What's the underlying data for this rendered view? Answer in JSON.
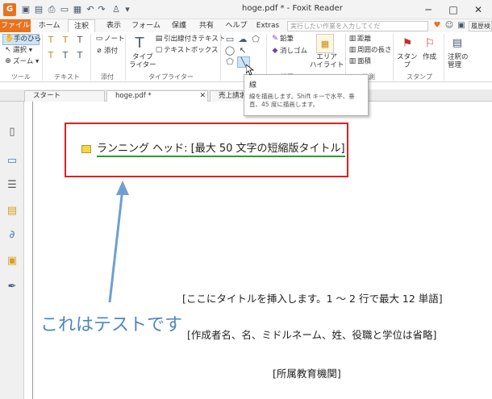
{
  "window": {
    "title": "hoge.pdf * - Foxit Reader",
    "logo": "G",
    "minimize": "─",
    "maximize": "□",
    "close": "✕"
  },
  "ribbon_tabs": {
    "file": "ファイル",
    "home": "ホーム",
    "comment": "注釈",
    "view": "表示",
    "form": "フォーム",
    "protect": "保護",
    "share": "共有",
    "help": "ヘルプ",
    "extras": "Extras"
  },
  "search": {
    "placeholder": "実行したい作業を入力してくだ",
    "find_placeholder": "履歴検"
  },
  "ribbon": {
    "tools": {
      "hand": "手のひら",
      "select": "選択",
      "zoom": "ズーム",
      "label": "ツール"
    },
    "text": {
      "label": "テキスト"
    },
    "attach": {
      "note": "ノート",
      "file": "添付",
      "label": "添付"
    },
    "typewriter": {
      "typewriter": "タイプ\nライター",
      "callout": "引出線付きテキスト",
      "textbox": "テキストボックス",
      "label": "タイプライター"
    },
    "drawing": {
      "pencil": "鉛筆",
      "eraser": "消しゴム",
      "label": "描画"
    },
    "area_highlight": "エリア\nハイライト",
    "measure": {
      "distance": "距離",
      "perimeter": "周囲の長さ",
      "area": "面積",
      "label": "計測"
    },
    "stamp": {
      "stamp": "スタン\nプ",
      "create": "作成",
      "label": "スタンプ"
    },
    "manage": {
      "label": "注釈の\n管理"
    }
  },
  "tooltip": {
    "title": "線",
    "description": "線を描画します。Shift キーで水平、垂直、45 度に描画します。"
  },
  "doc_tabs": [
    {
      "label": "スタート"
    },
    {
      "label": "hoge.pdf *"
    },
    {
      "label": "売上請求書"
    }
  ],
  "document": {
    "running_head": "ランニング ヘッド: [最大 50 文字の短縮版タイトル]",
    "title_line": "[ここにタイトルを挿入します。1 ～ 2 行で最大 12 単語]",
    "author_line": "[作成者名、名、ミドルネーム、姓、役職と学位は省略]",
    "affiliation_line": "[所属教育機関]",
    "annotation": "これはテストです"
  },
  "colors": {
    "accent": "#e8731f",
    "highlight_box": "#e01f1f",
    "underline": "#2e9a2e",
    "annotation": "#4e86c0"
  }
}
